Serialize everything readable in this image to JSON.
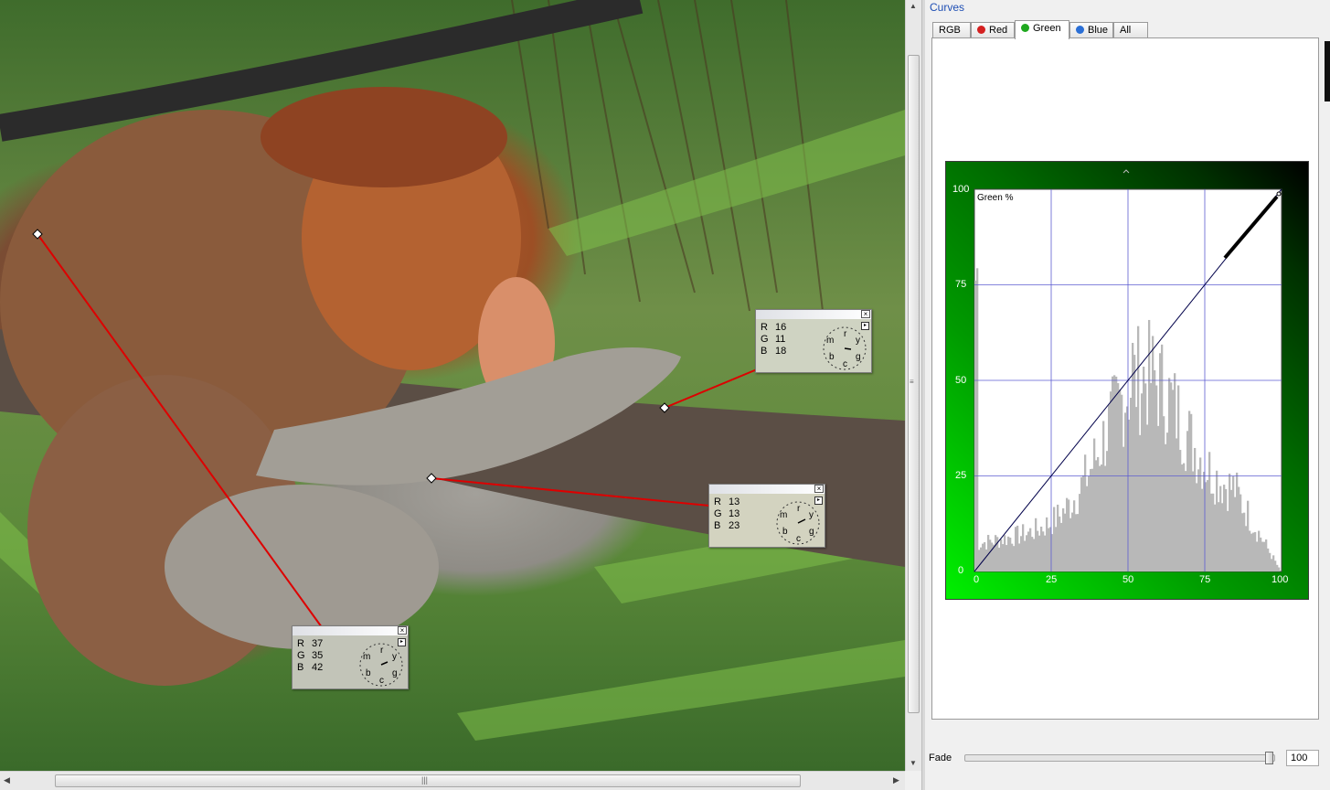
{
  "panel": {
    "title": "Curves",
    "tabs": [
      {
        "label": "RGB",
        "dot": ""
      },
      {
        "label": "Red",
        "dot": "#d42020"
      },
      {
        "label": "Green",
        "dot": "#1fa81f"
      },
      {
        "label": "Blue",
        "dot": "#2a6fd6"
      },
      {
        "label": "All",
        "dot": ""
      }
    ],
    "active_tab": "Green",
    "graph_label": "Green %",
    "axis_ticks": [
      "0",
      "25",
      "50",
      "75",
      "100"
    ],
    "fade_label": "Fade",
    "fade_value": "100"
  },
  "samplers": [
    {
      "r_label": "R",
      "r": "16",
      "g_label": "G",
      "g": "11",
      "b_label": "B",
      "b": "18"
    },
    {
      "r_label": "R",
      "r": "13",
      "g_label": "G",
      "g": "13",
      "b_label": "B",
      "b": "23"
    },
    {
      "r_label": "R",
      "r": "37",
      "g_label": "G",
      "g": "35",
      "b_label": "B",
      "b": "42"
    }
  ],
  "wheel_letters": [
    "r",
    "y",
    "g",
    "c",
    "b",
    "m"
  ],
  "scroll": {
    "grip": "|||"
  },
  "colors": {
    "accent_title": "#1f4fb4",
    "sampler_line": "#dd0000",
    "histogram": "#b8b8b8"
  }
}
